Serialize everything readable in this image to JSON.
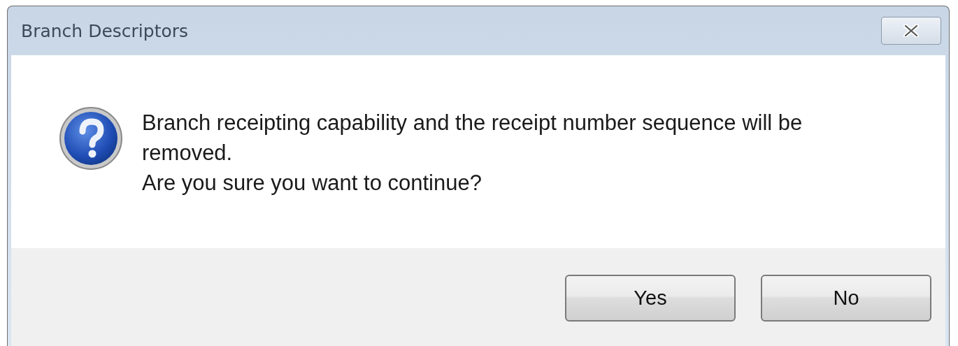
{
  "window": {
    "title": "Branch Descriptors"
  },
  "message": [
    "Branch receipting capability and the receipt number sequence will be removed.",
    "Are you sure you want to continue?"
  ],
  "buttons": [
    {
      "label": "Yes"
    },
    {
      "label": "No"
    }
  ]
}
